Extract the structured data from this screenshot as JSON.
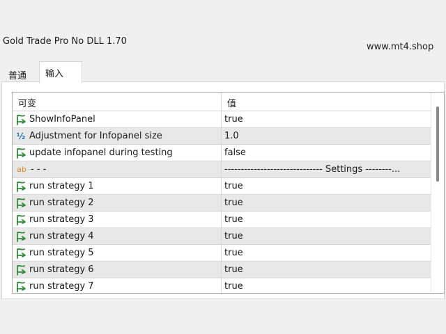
{
  "window": {
    "title": "Gold Trade Pro No DLL 1.70"
  },
  "watermark": "www.mt4.shop",
  "tabs": [
    {
      "label": "普通"
    },
    {
      "label": "输入"
    }
  ],
  "table": {
    "headers": {
      "variable": "可变",
      "value": "值"
    },
    "rows": [
      {
        "icon": "bool-arrow-icon",
        "name": "ShowInfoPanel",
        "value": "true"
      },
      {
        "icon": "half-fraction-icon",
        "name": "Adjustment for Infopanel size",
        "value": "1.0"
      },
      {
        "icon": "bool-arrow-icon",
        "name": "update infopanel during testing",
        "value": "false"
      },
      {
        "icon": "ab-string-icon",
        "name": "- - -",
        "value": "------------------------------ Settings --------..."
      },
      {
        "icon": "bool-arrow-icon",
        "name": "run strategy 1",
        "value": "true"
      },
      {
        "icon": "bool-arrow-icon",
        "name": "run strategy 2",
        "value": "true"
      },
      {
        "icon": "bool-arrow-icon",
        "name": "run strategy 3",
        "value": "true"
      },
      {
        "icon": "bool-arrow-icon",
        "name": "run strategy 4",
        "value": "true"
      },
      {
        "icon": "bool-arrow-icon",
        "name": "run strategy 5",
        "value": "true"
      },
      {
        "icon": "bool-arrow-icon",
        "name": "run strategy 6",
        "value": "true"
      },
      {
        "icon": "bool-arrow-icon",
        "name": "run strategy 7",
        "value": "true"
      }
    ]
  },
  "colors": {
    "bool_icon": "#2e8b3a",
    "half_icon": "#1f6fb8",
    "ab_icon": "#d88a1a",
    "alt_row": "#e8e8e8"
  }
}
